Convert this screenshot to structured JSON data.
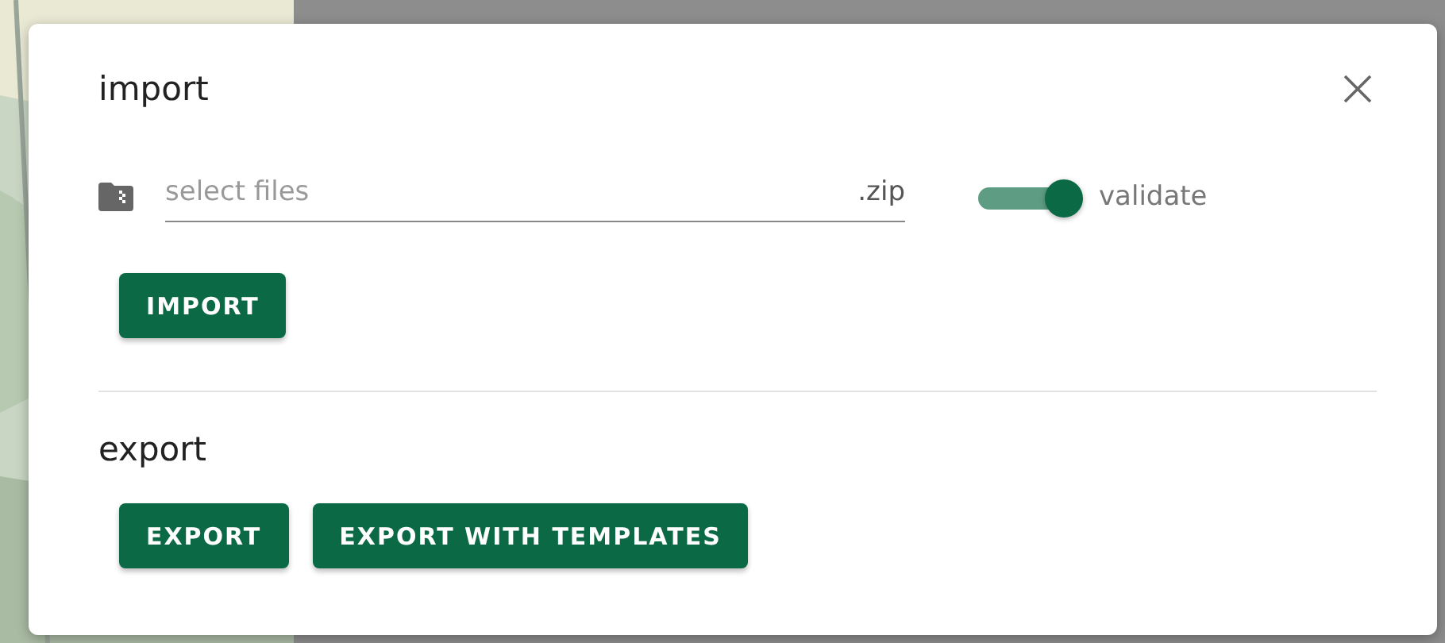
{
  "dialog": {
    "title": "import"
  },
  "import": {
    "file_field": {
      "placeholder": "select files",
      "suffix": ".zip"
    },
    "toggle": {
      "label": "validate",
      "on": true
    },
    "button": "IMPORT"
  },
  "export": {
    "title": "export",
    "buttons": [
      "EXPORT",
      "EXPORT WITH TEMPLATES"
    ]
  }
}
